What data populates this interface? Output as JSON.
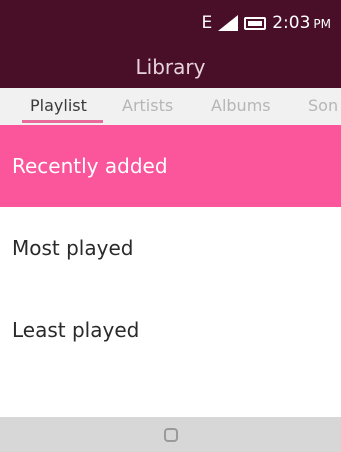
{
  "status_bar": {
    "network": "E",
    "time": "2:03",
    "ampm": "PM",
    "icons": [
      "signal-icon",
      "battery-icon"
    ]
  },
  "header": {
    "title": "Library"
  },
  "tabs": [
    {
      "label": "Playlist",
      "active": true
    },
    {
      "label": "Artists",
      "active": false
    },
    {
      "label": "Albums",
      "active": false
    },
    {
      "label": "Son",
      "active": false
    }
  ],
  "list": [
    {
      "label": "Recently added",
      "selected": true
    },
    {
      "label": "Most played",
      "selected": false
    },
    {
      "label": "Least played",
      "selected": false
    }
  ],
  "softkeys": {
    "center_icon": "circle-icon"
  },
  "colors": {
    "header_bg": "#4a0f28",
    "selected_bg": "#fb559c",
    "tab_underline": "#e76a9a",
    "softkey_bg": "#d7d7d7"
  }
}
